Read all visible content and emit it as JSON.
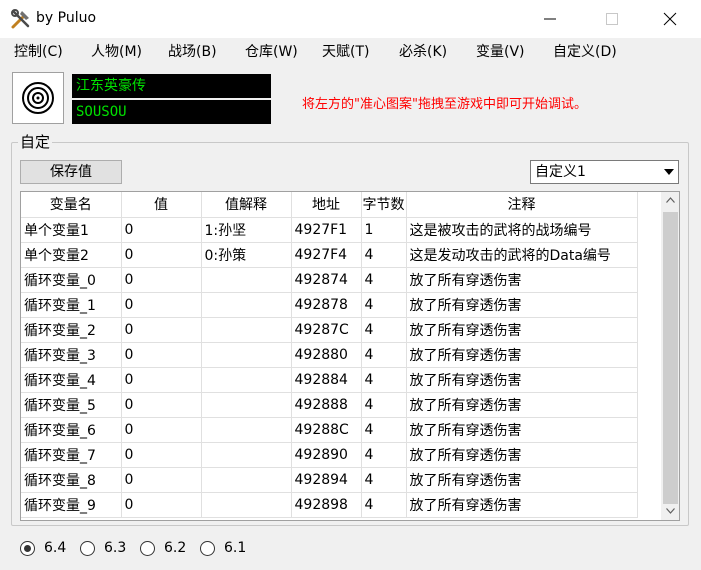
{
  "window": {
    "title": "by Puluo"
  },
  "menu": [
    "控制(C)",
    "人物(M)",
    "战场(B)",
    "仓库(W)",
    "天赋(T)",
    "必杀(K)",
    "变量(V)",
    "自定义(D)"
  ],
  "header": {
    "lcd_line1": "江东英豪传",
    "lcd_line2": "SOUSOU",
    "hint": "将左方的\"准心图案\"拖拽至游戏中即可开始调试。"
  },
  "group": {
    "title": "自定",
    "save_label": "保存值",
    "select_value": "自定义1"
  },
  "table": {
    "columns": [
      "变量名",
      "值",
      "值解释",
      "地址",
      "字节数",
      "注释"
    ],
    "rows": [
      [
        "单个变量1",
        "0",
        "1:孙坚",
        "4927F1",
        "1",
        "这是被攻击的武将的战场编号"
      ],
      [
        "单个变量2",
        "0",
        "0:孙策",
        "4927F4",
        "4",
        "这是发动攻击的武将的Data编号"
      ],
      [
        "循环变量_0",
        "0",
        "",
        "492874",
        "4",
        "放了所有穿透伤害"
      ],
      [
        "循环变量_1",
        "0",
        "",
        "492878",
        "4",
        "放了所有穿透伤害"
      ],
      [
        "循环变量_2",
        "0",
        "",
        "49287C",
        "4",
        "放了所有穿透伤害"
      ],
      [
        "循环变量_3",
        "0",
        "",
        "492880",
        "4",
        "放了所有穿透伤害"
      ],
      [
        "循环变量_4",
        "0",
        "",
        "492884",
        "4",
        "放了所有穿透伤害"
      ],
      [
        "循环变量_5",
        "0",
        "",
        "492888",
        "4",
        "放了所有穿透伤害"
      ],
      [
        "循环变量_6",
        "0",
        "",
        "49288C",
        "4",
        "放了所有穿透伤害"
      ],
      [
        "循环变量_7",
        "0",
        "",
        "492890",
        "4",
        "放了所有穿透伤害"
      ],
      [
        "循环变量_8",
        "0",
        "",
        "492894",
        "4",
        "放了所有穿透伤害"
      ],
      [
        "循环变量_9",
        "0",
        "",
        "492898",
        "4",
        "放了所有穿透伤害"
      ]
    ]
  },
  "versions": [
    {
      "label": "6.4",
      "selected": true
    },
    {
      "label": "6.3",
      "selected": false
    },
    {
      "label": "6.2",
      "selected": false
    },
    {
      "label": "6.1",
      "selected": false
    }
  ],
  "icons": {
    "app": "tools-icon",
    "target": "crosshair-target-icon",
    "minimize": "minimize-icon",
    "maximize": "maximize-icon",
    "close": "close-icon"
  },
  "colors": {
    "lcd_text": "#00e000",
    "hint": "#ff0000"
  }
}
